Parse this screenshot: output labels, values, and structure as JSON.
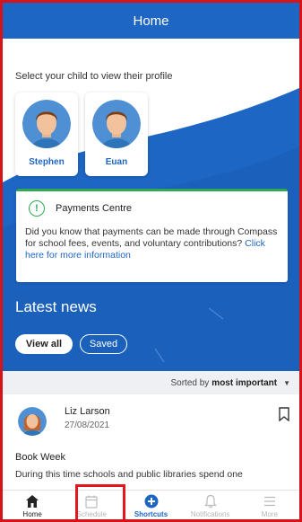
{
  "header": {
    "title": "Home"
  },
  "profiles": {
    "prompt": "Select your child to view their profile",
    "children": [
      {
        "name": "Stephen"
      },
      {
        "name": "Euan"
      }
    ]
  },
  "payments": {
    "title": "Payments Centre",
    "body": "Did you know that payments can be made through Compass for school fees, events, and voluntary contributions?",
    "link": "Click here for more information"
  },
  "news": {
    "title": "Latest news",
    "filters": {
      "view_all": "View all",
      "saved": "Saved"
    },
    "sort_prefix": "Sorted by",
    "sort_value": "most important",
    "post": {
      "author": "Liz Larson",
      "date": "27/08/2021",
      "title": "Book Week",
      "preview": "During this time schools and public libraries spend one"
    }
  },
  "tabbar": {
    "tabs": [
      {
        "label": "Home",
        "icon": "home-icon"
      },
      {
        "label": "Schedule",
        "icon": "calendar-icon"
      },
      {
        "label": "Shortcuts",
        "icon": "plus-circle-icon"
      },
      {
        "label": "Notifications",
        "icon": "bell-icon"
      },
      {
        "label": "More",
        "icon": "menu-icon"
      }
    ]
  },
  "colors": {
    "brand_blue": "#1e66c4",
    "success_green": "#2eaa56",
    "highlight_red": "#e3171f"
  }
}
